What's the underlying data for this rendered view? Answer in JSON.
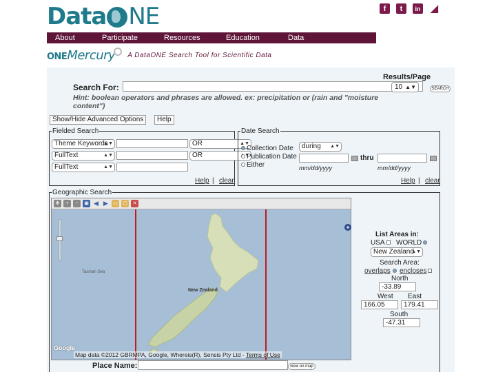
{
  "header": {
    "logo_data": "Data",
    "logo_ne": "NE",
    "social": [
      "facebook-icon",
      "twitter-icon",
      "linkedin-icon",
      "rss-icon"
    ],
    "social_glyphs": [
      "f",
      "t",
      "in",
      "∷"
    ]
  },
  "nav": [
    "About",
    "Participate",
    "Resources",
    "Education",
    "Data"
  ],
  "subhead": {
    "one": "ONE",
    "mercury": "Mercury",
    "tagline": "A DataONE Search Tool for Scientific Data"
  },
  "search": {
    "label": "Search For:",
    "value": "",
    "hint": "Hint: boolean operators and phrases are allowed. ex: precipitation or (rain and \"moisture content\")",
    "results_label": "Results/Page",
    "results_value": "10",
    "search_button": "SEARCH"
  },
  "buttons": {
    "advanced": "Show/Hide Advanced Options",
    "help": "Help"
  },
  "fielded": {
    "legend": "Fielded Search",
    "rows": [
      {
        "field": "Theme Keywords",
        "value": "",
        "op": "OR"
      },
      {
        "field": "FullText",
        "value": "",
        "op": "OR"
      },
      {
        "field": "FullText",
        "value": ""
      }
    ],
    "help": "Help",
    "sep": "|",
    "clear": "clear"
  },
  "date": {
    "legend": "Date Search",
    "options": [
      "Collection Date",
      "Publication Date",
      "Either"
    ],
    "selected": "Collection Date",
    "mode": "during",
    "thru": "thru",
    "format": "mm/dd/yyyy",
    "help": "Help",
    "sep": "|",
    "clear": "clear"
  },
  "geo": {
    "legend": "Geographic Search",
    "map_labels": {
      "sea": "Tasman Sea",
      "nz": "New Zealand"
    },
    "google": "Google",
    "map_data_prefix": "Map data ©2012 GBRMPA, Google, Whereis(R), Sensis Pty Ltd -",
    "terms": "Terms of Use",
    "list_areas": "List Areas in:",
    "usa": "USA",
    "world": "WORLD",
    "area_value": "New Zealand",
    "search_area": "Search Area:",
    "overlaps": "overlaps",
    "encloses": "encloses",
    "north_label": "North",
    "north": "-33.89",
    "west_label": "West",
    "west": "166.05",
    "east_label": "East",
    "east": "179.41",
    "south_label": "South",
    "south": "-47.31",
    "place_label": "Place Name:",
    "place_value": "",
    "view_button": "view on map"
  },
  "colors": {
    "brand_teal": "#1f7a8c",
    "brand_maroon": "#5e1538",
    "panel_bg": "#eef4f8",
    "bbox_line": "#c21a1a"
  }
}
